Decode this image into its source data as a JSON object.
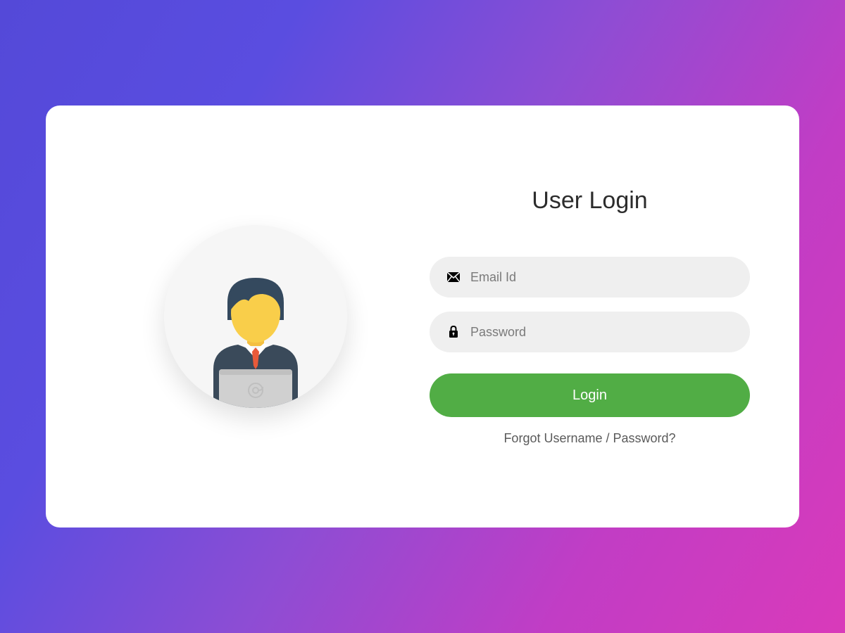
{
  "title": "User Login",
  "fields": {
    "email": {
      "placeholder": "Email Id"
    },
    "password": {
      "placeholder": "Password"
    }
  },
  "buttons": {
    "login": "Login"
  },
  "links": {
    "forgot": "Forgot Username / Password?"
  }
}
